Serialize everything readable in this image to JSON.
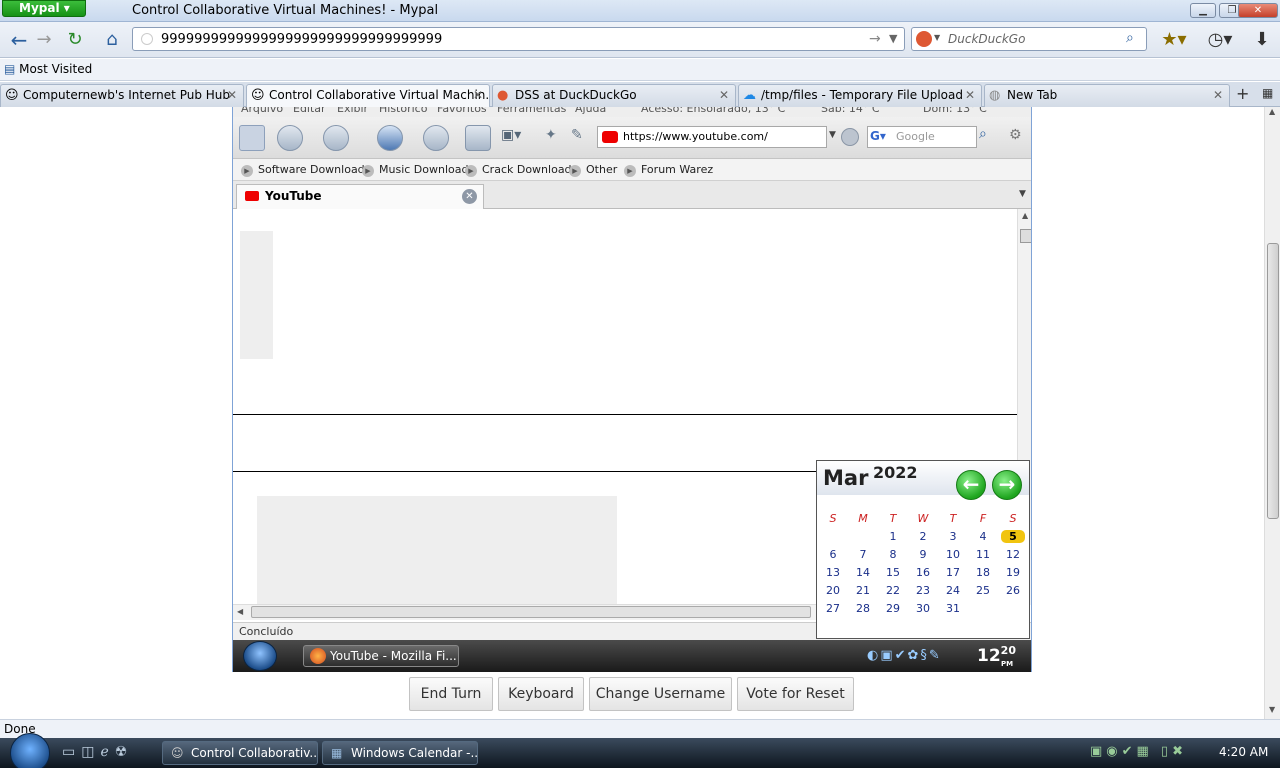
{
  "browser": {
    "app_menu": "Mypal",
    "window_title": "Control Collaborative Virtual Machines! - Mypal",
    "url": "9999999999999999999999999999999999",
    "search_placeholder": "DuckDuckGo",
    "bookmarks": [
      "Most Visited"
    ],
    "tabs": [
      {
        "label": "Computernewb's Internet Pub Hub",
        "active": false
      },
      {
        "label": "Control Collaborative Virtual Machin...",
        "active": true
      },
      {
        "label": "DSS at DuckDuckGo",
        "active": false
      },
      {
        "label": "/tmp/files - Temporary File Upload",
        "active": false
      },
      {
        "label": "New Tab",
        "active": false
      }
    ],
    "status": "Done"
  },
  "vm": {
    "menu": [
      "Arquivo",
      "Editar",
      "Exibir",
      "Histórico",
      "Favoritos",
      "Ferramentas",
      "Ajuda"
    ],
    "weather": [
      "Acesso: Ensolarado, 13° C",
      "Sáb: 14° C",
      "Dom: 13° C"
    ],
    "url": "https://www.youtube.com/",
    "search_placeholder": "Google",
    "bookmarks": [
      "Software Download",
      "Music Download",
      "Crack Download",
      "Other",
      "Forum Warez"
    ],
    "tab_label": "YouTube",
    "status": "Concluído",
    "taskbar_button": "YouTube - Mozilla Fi...",
    "clock_hour": "12",
    "clock_minute": "20",
    "clock_ampm": "PM",
    "calendar": {
      "month": "Mar",
      "year": "2022",
      "day_headers": [
        "S",
        "M",
        "T",
        "W",
        "T",
        "F",
        "S"
      ],
      "weeks": [
        [
          "",
          "",
          "1",
          "2",
          "3",
          "4",
          "5"
        ],
        [
          "6",
          "7",
          "8",
          "9",
          "10",
          "11",
          "12"
        ],
        [
          "13",
          "14",
          "15",
          "16",
          "17",
          "18",
          "19"
        ],
        [
          "20",
          "21",
          "22",
          "23",
          "24",
          "25",
          "26"
        ],
        [
          "27",
          "28",
          "29",
          "30",
          "31",
          "",
          ""
        ]
      ],
      "today": "5"
    }
  },
  "controls": {
    "end_turn": "End Turn",
    "keyboard": "Keyboard",
    "change_username": "Change Username",
    "vote_reset": "Vote for Reset"
  },
  "taskbar": {
    "buttons": [
      "Control Collaborativ...",
      "Windows Calendar -..."
    ],
    "clock": "4:20 AM"
  },
  "colors": {
    "app_menu": "#169216",
    "accent": "#2b5f9e",
    "calendar_today": "#f1c40f"
  }
}
